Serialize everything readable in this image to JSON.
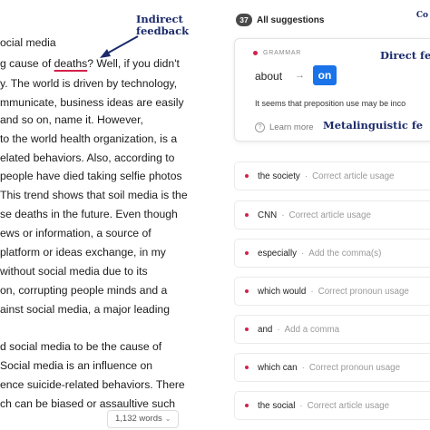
{
  "essay": {
    "lines": [
      "ocial media",
      "g cause of ",
      "y. The world is driven by technology,",
      "mmunicate, business ideas are easily",
      "and so on, name it. However,",
      "to the world health organization, is a",
      "elated behaviors. Also, according to",
      "people have died taking selfie photos",
      "This trend shows that soil media is the",
      "se deaths in the future.  Even though",
      "ews or information, a source of",
      "platform or ideas exchange, in my",
      "without social media due to its",
      "on, corrupting people minds and a",
      "ainst social media, a major leading",
      "d social media to be the cause of",
      "Social media is an influence on",
      "ence suicide-related behaviors. There",
      "ch can be biased or assaultive such"
    ],
    "underlined_word": "deaths",
    "after_underlined": "? Well, if you didn't",
    "word_count": "1,132 words"
  },
  "annotations": {
    "indirect_feedback": "Indirect\nfeedback",
    "direct_feedback": "Direct fee",
    "metalinguistic_feedback": "Metalinguistic fe",
    "cut_top_label": "Co"
  },
  "suggestions": {
    "count": "37",
    "title": "All suggestions",
    "card": {
      "category": "GRAMMAR",
      "original": "about",
      "replacement": "on",
      "explanation": "It seems that preposition use may be inco",
      "learn_more": "Learn more"
    },
    "rows": [
      {
        "phrase": "the society",
        "action": "Correct article usage"
      },
      {
        "phrase": "CNN",
        "action": "Correct article usage"
      },
      {
        "phrase": "especially",
        "action": "Add the comma(s)"
      },
      {
        "phrase": "which would",
        "action": "Correct pronoun usage"
      },
      {
        "phrase": "and",
        "action": "Add a comma"
      },
      {
        "phrase": "which can",
        "action": "Correct pronoun usage"
      },
      {
        "phrase": "the social",
        "action": "Correct article usage"
      }
    ]
  },
  "colors": {
    "accent_blue": "#1a73e8",
    "error_red": "#d2224a",
    "annotation_navy": "#1b2a6b"
  }
}
